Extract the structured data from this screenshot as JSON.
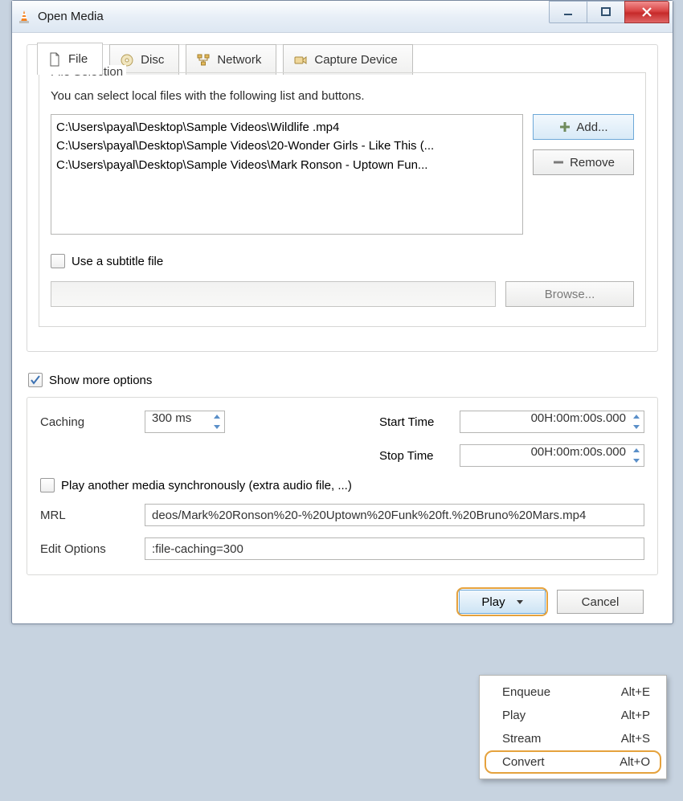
{
  "window": {
    "title": "Open Media"
  },
  "tabs": [
    {
      "label": "File",
      "icon": "file-icon"
    },
    {
      "label": "Disc",
      "icon": "disc-icon"
    },
    {
      "label": "Network",
      "icon": "network-icon"
    },
    {
      "label": "Capture Device",
      "icon": "capture-icon"
    }
  ],
  "fileSelection": {
    "legend": "File Selection",
    "description": "You can select local files with the following list and buttons.",
    "files": [
      "C:\\Users\\payal\\Desktop\\Sample Videos\\Wildlife .mp4",
      "C:\\Users\\payal\\Desktop\\Sample Videos\\20-Wonder Girls - Like This (...",
      "C:\\Users\\payal\\Desktop\\Sample Videos\\Mark Ronson - Uptown Fun..."
    ],
    "addLabel": "Add...",
    "removeLabel": "Remove",
    "subtitleCheckbox": "Use a subtitle file",
    "browseLabel": "Browse..."
  },
  "showMore": {
    "label": "Show more options",
    "checked": true
  },
  "options": {
    "cachingLabel": "Caching",
    "cachingValue": "300 ms",
    "startTimeLabel": "Start Time",
    "startTimeValue": "00H:00m:00s.000",
    "stopTimeLabel": "Stop Time",
    "stopTimeValue": "00H:00m:00s.000",
    "syncLabel": "Play another media synchronously (extra audio file, ...)",
    "mrlLabel": "MRL",
    "mrlValue": "deos/Mark%20Ronson%20-%20Uptown%20Funk%20ft.%20Bruno%20Mars.mp4",
    "editLabel": "Edit Options",
    "editValue": ":file-caching=300"
  },
  "bottom": {
    "play": "Play",
    "cancel": "Cancel"
  },
  "dropdown": [
    {
      "label": "Enqueue",
      "shortcut": "Alt+E"
    },
    {
      "label": "Play",
      "shortcut": "Alt+P"
    },
    {
      "label": "Stream",
      "shortcut": "Alt+S"
    },
    {
      "label": "Convert",
      "shortcut": "Alt+O",
      "highlight": true
    }
  ]
}
